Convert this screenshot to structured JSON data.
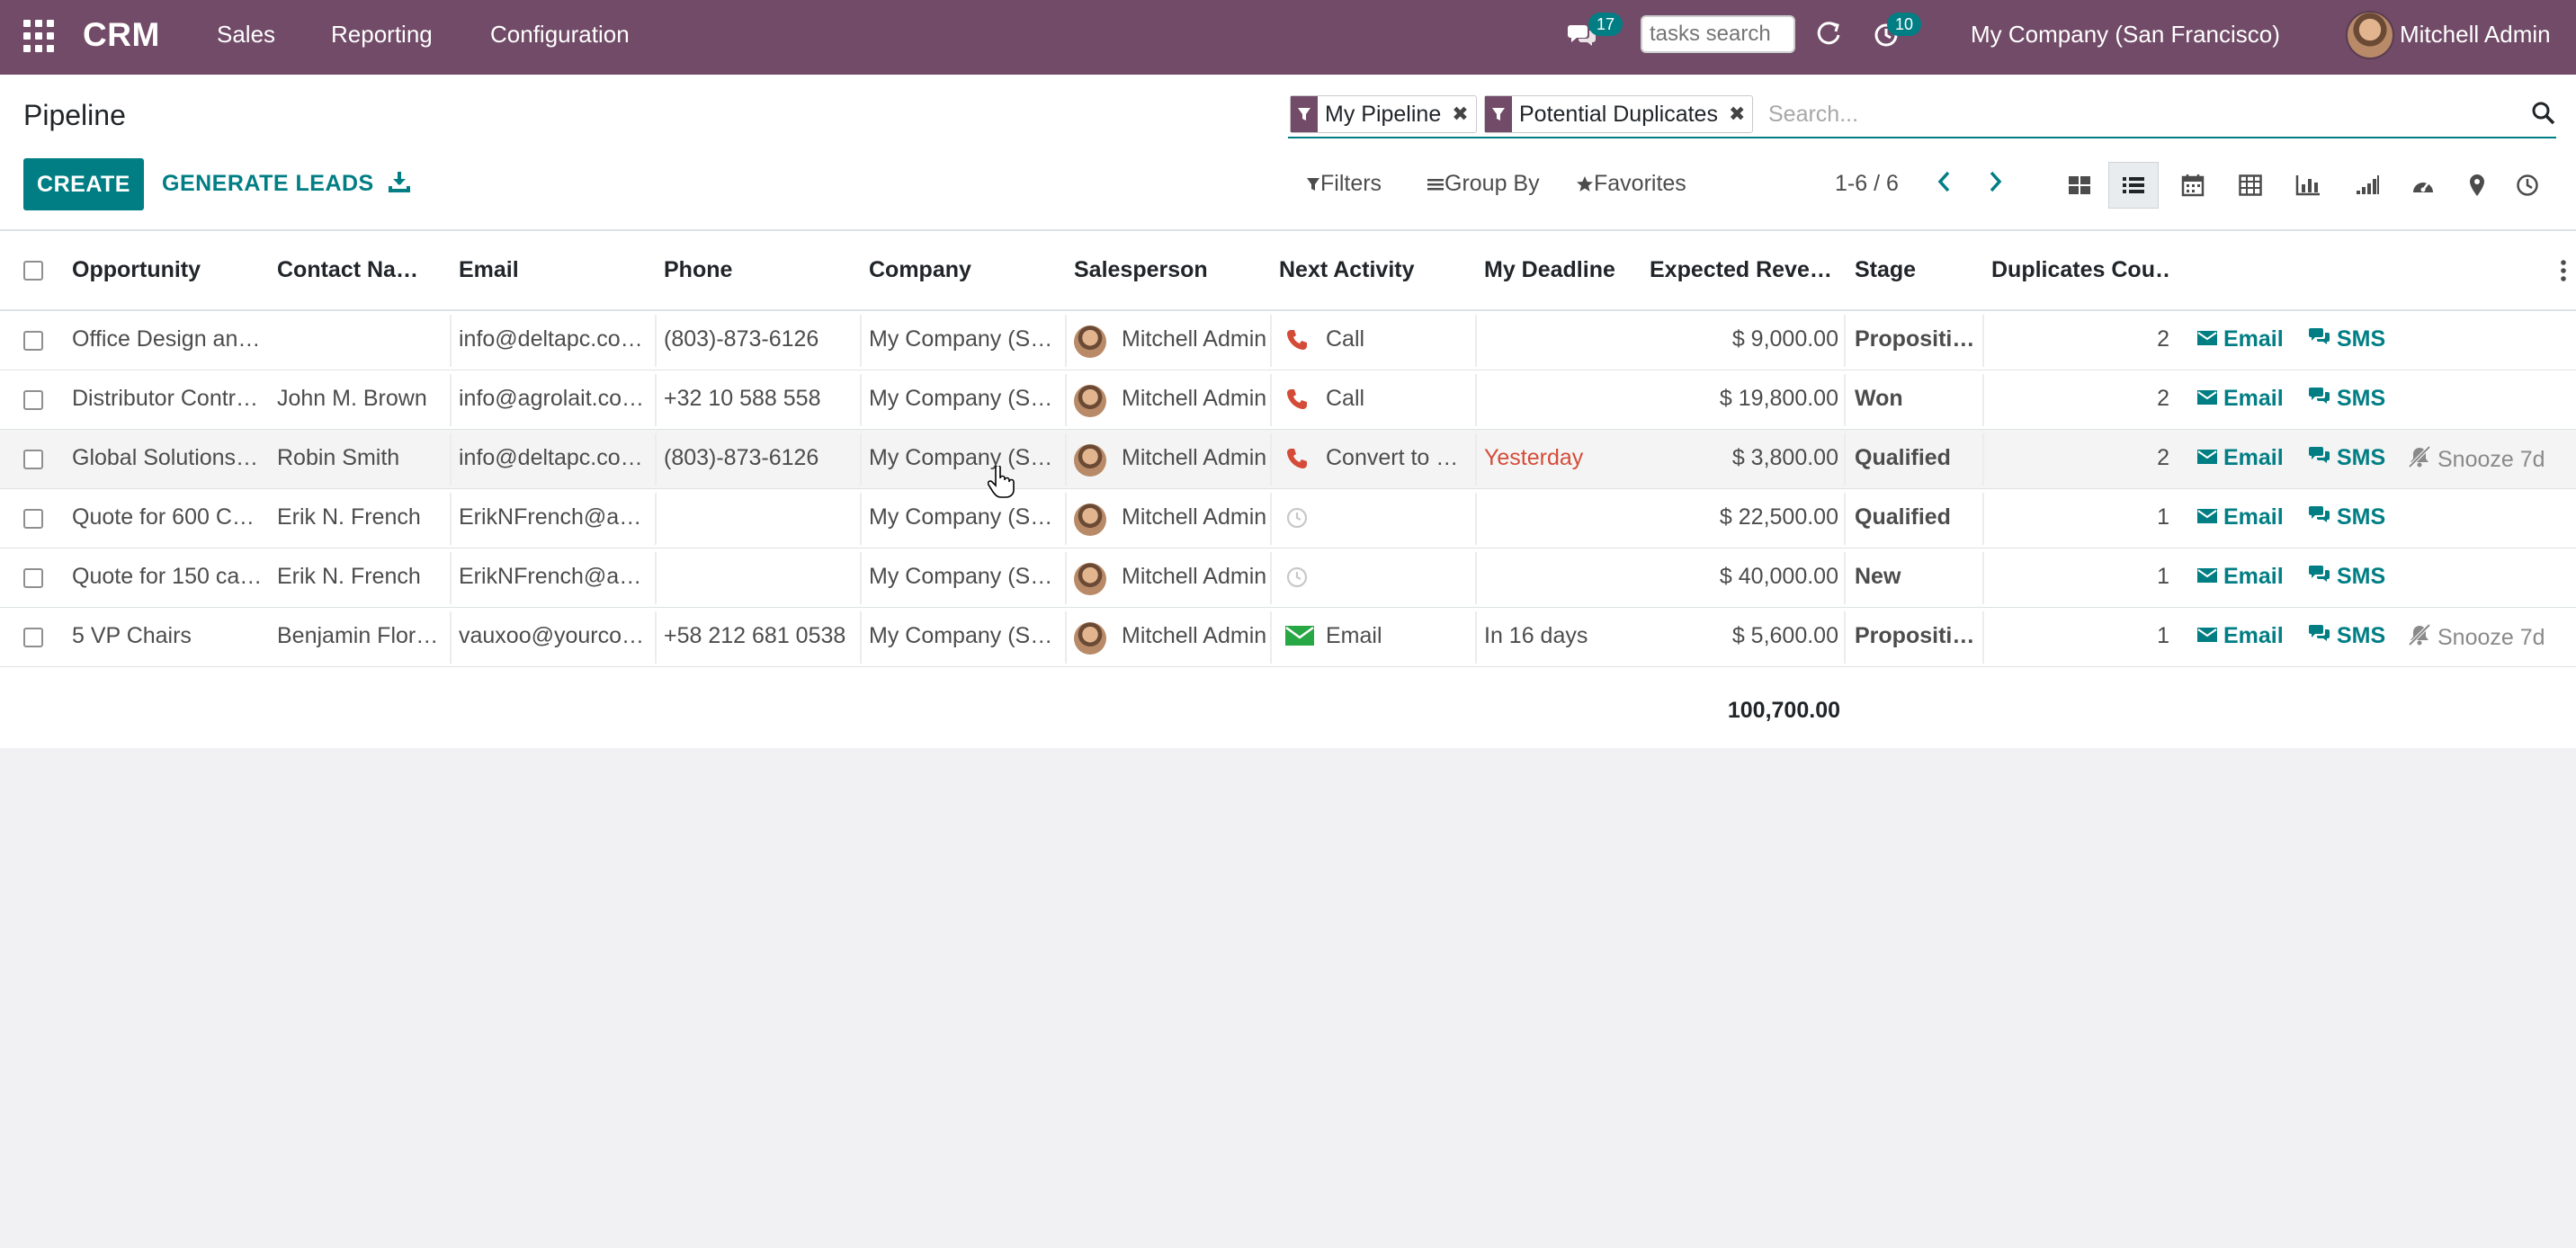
{
  "navbar": {
    "brand": "CRM",
    "menu": [
      "Sales",
      "Reporting",
      "Configuration"
    ],
    "chat_badge": "17",
    "tasks_placeholder": "tasks search",
    "activity_badge": "10",
    "company": "My Company (San Francisco)",
    "user": "Mitchell Admin",
    "icons": [
      "apps-grid-icon",
      "chat-icon",
      "refresh-icon",
      "clock-icon"
    ]
  },
  "control_panel": {
    "title": "Pipeline",
    "create_label": "CREATE",
    "generate_label": "GENERATE LEADS",
    "facets": [
      {
        "label": "My Pipeline"
      },
      {
        "label": "Potential Duplicates"
      }
    ],
    "search_placeholder": "Search...",
    "filters_label": "Filters",
    "groupby_label": "Group By",
    "favorites_label": "Favorites",
    "pager": "1-6 / 6",
    "views": [
      "kanban",
      "list",
      "calendar",
      "pivot",
      "graph",
      "cohort",
      "dashboard",
      "map",
      "activity"
    ],
    "active_view": "list"
  },
  "list": {
    "headers": {
      "opportunity": "Opportunity",
      "contact": "Contact Na…",
      "email": "Email",
      "phone": "Phone",
      "company": "Company",
      "salesperson": "Salesperson",
      "next_activity": "Next Activity",
      "deadline": "My Deadline",
      "revenue": "Expected Reve…",
      "stage": "Stage",
      "duplicates": "Duplicates Cou…"
    },
    "rows": [
      {
        "opportunity": "Office Design an…",
        "contact": "",
        "email": "info@deltapc.co…",
        "phone": "(803)-873-6126",
        "company": "My Company (S…",
        "salesperson": "Mitchell Admin",
        "activity_type": "phone",
        "activity": "Call",
        "deadline": "",
        "revenue": "$ 9,000.00",
        "stage": "Propositi…",
        "duplicates": "2",
        "email_btn": "Email",
        "sms_btn": "SMS",
        "snooze": ""
      },
      {
        "opportunity": "Distributor Contr…",
        "contact": "John M. Brown",
        "email": "info@agrolait.co…",
        "phone": "+32 10 588 558",
        "company": "My Company (S…",
        "salesperson": "Mitchell Admin",
        "activity_type": "phone",
        "activity": "Call",
        "deadline": "",
        "revenue": "$ 19,800.00",
        "stage": "Won",
        "duplicates": "2",
        "email_btn": "Email",
        "sms_btn": "SMS",
        "snooze": ""
      },
      {
        "opportunity": "Global Solutions…",
        "contact": "Robin Smith",
        "email": "info@deltapc.co…",
        "phone": "(803)-873-6126",
        "company": "My Company (S…",
        "salesperson": "Mitchell Admin",
        "activity_type": "phone",
        "activity": "Convert to q…",
        "deadline": "Yesterday",
        "revenue": "$ 3,800.00",
        "stage": "Qualified",
        "duplicates": "2",
        "email_btn": "Email",
        "sms_btn": "SMS",
        "snooze": "Snooze 7d"
      },
      {
        "opportunity": "Quote for 600 C…",
        "contact": "Erik N. French",
        "email": "ErikNFrench@ar…",
        "phone": "",
        "company": "My Company (S…",
        "salesperson": "Mitchell Admin",
        "activity_type": "clock",
        "activity": "",
        "deadline": "",
        "revenue": "$ 22,500.00",
        "stage": "Qualified",
        "duplicates": "1",
        "email_btn": "Email",
        "sms_btn": "SMS",
        "snooze": ""
      },
      {
        "opportunity": "Quote for 150 ca…",
        "contact": "Erik N. French",
        "email": "ErikNFrench@ar…",
        "phone": "",
        "company": "My Company (S…",
        "salesperson": "Mitchell Admin",
        "activity_type": "clock",
        "activity": "",
        "deadline": "",
        "revenue": "$ 40,000.00",
        "stage": "New",
        "duplicates": "1",
        "email_btn": "Email",
        "sms_btn": "SMS",
        "snooze": ""
      },
      {
        "opportunity": "5 VP Chairs",
        "contact": "Benjamin Flor…",
        "email": "vauxoo@yourco…",
        "phone": "+58 212 681 0538",
        "company": "My Company (S…",
        "salesperson": "Mitchell Admin",
        "activity_type": "envelope",
        "activity": "Email",
        "deadline": "In 16 days",
        "revenue": "$ 5,600.00",
        "stage": "Propositi…",
        "duplicates": "1",
        "email_btn": "Email",
        "sms_btn": "SMS",
        "snooze": "Snooze 7d"
      }
    ],
    "total_revenue": "100,700.00"
  },
  "colors": {
    "brand": "#714b67",
    "accent": "#017e84",
    "overdue": "#d44c38",
    "phone_icon": "#d44c38",
    "email_activity": "#28a745"
  }
}
